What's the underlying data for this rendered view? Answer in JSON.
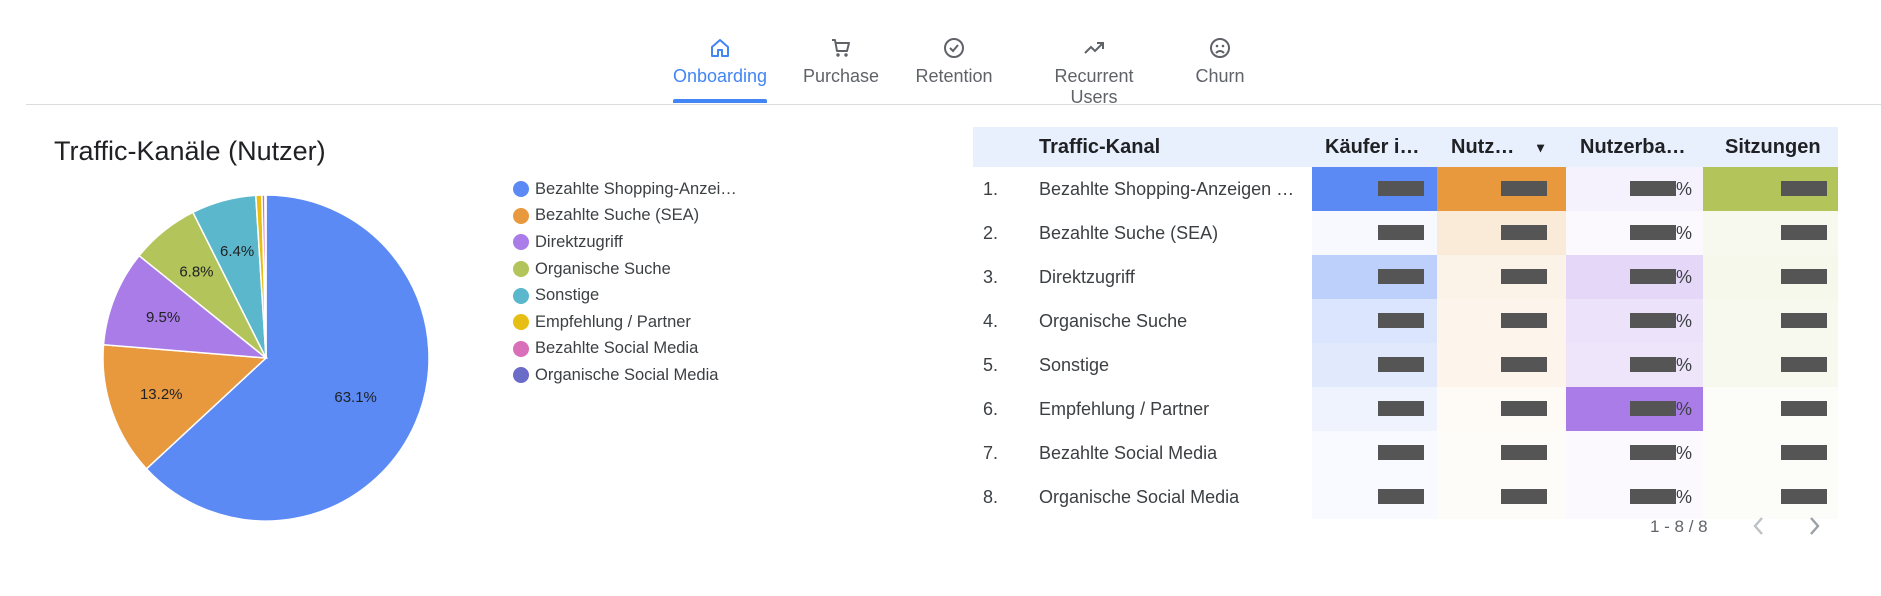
{
  "tabs": [
    {
      "label": "Onboarding",
      "icon": "home-icon",
      "active": true
    },
    {
      "label": "Purchase",
      "icon": "cart-icon",
      "active": false
    },
    {
      "label": "Retention",
      "icon": "check-circle-icon",
      "active": false
    },
    {
      "label": "Recurrent Users",
      "icon": "trending-up-icon",
      "active": false
    },
    {
      "label": "Churn",
      "icon": "sad-face-icon",
      "active": false
    }
  ],
  "chart_data": {
    "type": "pie",
    "title": "Traffic-Kanäle (Nutzer)",
    "legend_position": "right",
    "slices": [
      {
        "label": "Bezahlte Shopping-Anzei…",
        "value": 63.1,
        "value_label": "63.1%",
        "color": "#5b8af5"
      },
      {
        "label": "Bezahlte Suche (SEA)",
        "value": 13.2,
        "value_label": "13.2%",
        "color": "#e8993e"
      },
      {
        "label": "Direktzugriff",
        "value": 9.5,
        "value_label": "9.5%",
        "color": "#a97ce8"
      },
      {
        "label": "Organische Suche",
        "value": 6.8,
        "value_label": "6.8%",
        "color": "#b2c45a"
      },
      {
        "label": "Sonstige",
        "value": 6.4,
        "value_label": "6.4%",
        "color": "#5bb8cc"
      },
      {
        "label": "Empfehlung / Partner",
        "value": 0.6,
        "value_label": "",
        "color": "#e6be14"
      },
      {
        "label": "Bezahlte Social Media",
        "value": 0.3,
        "value_label": "",
        "color": "#d96fb8"
      },
      {
        "label": "Organische Social Media",
        "value": 0.1,
        "value_label": "",
        "color": "#6b6bc8"
      }
    ]
  },
  "table": {
    "headers": [
      "Traffic-Kanal",
      "Käufer i…",
      "Nutz…",
      "Nutzerba…",
      "Sitzungen"
    ],
    "sort_indicator": "▾",
    "rows": [
      {
        "index": "1.",
        "name": "Bezahlte Shopping-Anzeigen …",
        "pct_suffix": "%"
      },
      {
        "index": "2.",
        "name": "Bezahlte Suche (SEA)",
        "pct_suffix": "%"
      },
      {
        "index": "3.",
        "name": "Direktzugriff",
        "pct_suffix": "%"
      },
      {
        "index": "4.",
        "name": "Organische Suche",
        "pct_suffix": "%"
      },
      {
        "index": "5.",
        "name": "Sonstige",
        "pct_suffix": "%"
      },
      {
        "index": "6.",
        "name": "Empfehlung / Partner",
        "pct_suffix": "%"
      },
      {
        "index": "7.",
        "name": "Bezahlte Social Media",
        "pct_suffix": "%"
      },
      {
        "index": "8.",
        "name": "Organische Social Media",
        "pct_suffix": "%"
      }
    ],
    "heat": {
      "col1_color": "#5b8af5",
      "col1_alpha": [
        1.0,
        0.05,
        0.4,
        0.22,
        0.18,
        0.1,
        0.04,
        0.04
      ],
      "col2_color": "#e8993e",
      "col2_alpha": [
        1.0,
        0.2,
        0.12,
        0.1,
        0.1,
        0.04,
        0.03,
        0.03
      ],
      "col3_color": "#a97ce8",
      "col3_alpha": [
        0.1,
        0.05,
        0.3,
        0.22,
        0.2,
        1.0,
        0.05,
        0.05
      ],
      "col4_color": "#b2c45a",
      "col4_alpha": [
        1.0,
        0.1,
        0.12,
        0.1,
        0.1,
        0.04,
        0.04,
        0.04
      ]
    },
    "pagination": "1 - 8 / 8"
  },
  "icons": {
    "prev": "chevron-left-icon",
    "next": "chevron-right-icon"
  }
}
